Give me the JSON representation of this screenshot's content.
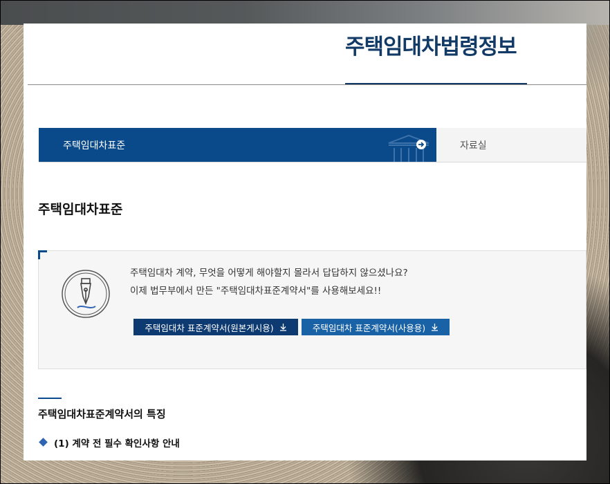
{
  "header": {
    "site_title": "주택임대차법령정보"
  },
  "tabs": [
    {
      "label": "주택임대차표준",
      "active": true
    },
    {
      "label": "자료실",
      "active": false
    }
  ],
  "main": {
    "page_title": "주택임대차표준",
    "info_box": {
      "line1": "주택임대차 계약, 무엇을 어떻게 해야할지 몰라서 답답하지 않으셨나요?",
      "line2": "이제 법무부에서 만든 \"주택임대차표준계약서\"를 사용해보세요!!",
      "buttons": [
        {
          "label": "주택임대차 표준계약서(원본게시용)",
          "icon": "download-icon"
        },
        {
          "label": "주택임대차 표준계약서(사용용)",
          "icon": "download-icon"
        }
      ]
    },
    "section_title": "주택임대차표준계약서의 특징",
    "subsection_label": "(1) 계약 전 필수 확인사항 안내"
  },
  "colors": {
    "primary": "#0a4a8a",
    "title": "#123a66",
    "button_dark": "#0e3a72",
    "button_light": "#1a62a6",
    "accent_diamond": "#2f64b5"
  }
}
